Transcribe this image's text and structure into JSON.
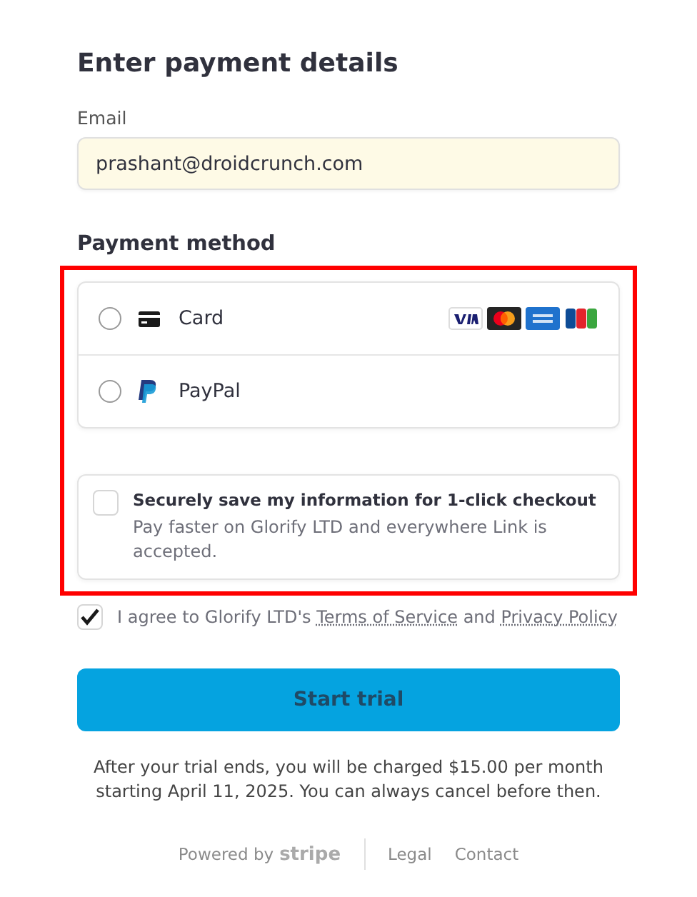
{
  "title": "Enter payment details",
  "email": {
    "label": "Email",
    "value": "prashant@droidcrunch.com"
  },
  "payment_method": {
    "heading": "Payment method",
    "highlighted": true,
    "options": [
      {
        "kind": "card",
        "label": "Card",
        "selected": false
      },
      {
        "kind": "paypal",
        "label": "PayPal",
        "selected": false
      }
    ],
    "save_info": {
      "checked": false,
      "title": "Securely save my information for 1-click checkout",
      "description": "Pay faster on Glorify LTD and everywhere Link is accepted."
    }
  },
  "agreement": {
    "checked": true,
    "text_before": "I agree to Glorify LTD's",
    "terms_link": "Terms of Service",
    "middle": "and",
    "privacy_link": "Privacy Policy"
  },
  "submit_button": "Start trial",
  "notice": "After your trial ends, you will be charged $15.00 per month starting April 11, 2025. You can always cancel before then.",
  "footer": {
    "powered_by": "Powered by",
    "brand": "stripe",
    "links": [
      "Legal",
      "Contact"
    ]
  }
}
